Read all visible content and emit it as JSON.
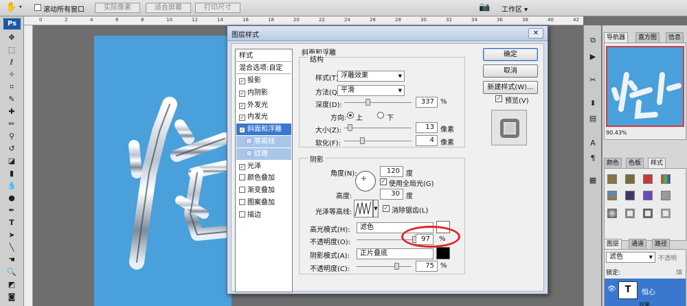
{
  "optionbar": {
    "scroll_all_label": "滚动所有窗口",
    "actual_pixels": "实际像素",
    "fit_screen": "适合屏幕",
    "print_size": "打印尺寸",
    "workspace": "工作区"
  },
  "toolbox": {
    "logo": "Ps"
  },
  "ruler_labels": [
    "0",
    "2",
    "4",
    "6",
    "8",
    "10",
    "12",
    "14",
    "16",
    "18",
    "20",
    "22",
    "24",
    "26",
    "28",
    "30",
    "32",
    "34",
    "36",
    "38",
    "40",
    "42"
  ],
  "canvas_text": "恒心",
  "dialog": {
    "title": "图层样式",
    "style_header": "样式",
    "blend_options": "混合选项:自定",
    "items": [
      {
        "label": "投影",
        "checked": true,
        "selected": false,
        "sub": false
      },
      {
        "label": "内阴影",
        "checked": true,
        "selected": false,
        "sub": false
      },
      {
        "label": "外发光",
        "checked": true,
        "selected": false,
        "sub": false
      },
      {
        "label": "内发光",
        "checked": true,
        "selected": false,
        "sub": false
      },
      {
        "label": "斜面和浮雕",
        "checked": true,
        "selected": true,
        "sub": false
      },
      {
        "label": "等高线",
        "checked": false,
        "selected": false,
        "sub": true
      },
      {
        "label": "纹理",
        "checked": false,
        "selected": false,
        "sub": true
      },
      {
        "label": "光泽",
        "checked": true,
        "selected": false,
        "sub": false
      },
      {
        "label": "颜色叠加",
        "checked": false,
        "selected": false,
        "sub": false
      },
      {
        "label": "渐变叠加",
        "checked": false,
        "selected": false,
        "sub": false
      },
      {
        "label": "图案叠加",
        "checked": false,
        "selected": false,
        "sub": false
      },
      {
        "label": "描边",
        "checked": false,
        "selected": false,
        "sub": false
      }
    ],
    "bevel": {
      "section": "斜面和浮雕",
      "structure": "结构",
      "style_label": "样式(T):",
      "style_value": "浮雕效果",
      "method_label": "方法(Q):",
      "method_value": "平滑",
      "depth_label": "深度(D):",
      "depth_value": "337",
      "depth_unit": "%",
      "depth_fraction": 0.34,
      "direction_label": "方向:",
      "dir_up": "上",
      "dir_down": "下",
      "size_label": "大小(Z):",
      "size_value": "13",
      "size_unit": "像素",
      "size_fraction": 0.05,
      "soften_label": "软化(F):",
      "soften_value": "4",
      "soften_unit": "像素",
      "soften_fraction": 0.25
    },
    "shading": {
      "section": "阴影",
      "angle_label": "角度(N):",
      "angle_value": "120",
      "angle_unit": "度",
      "global_light": "使用全局光(G)",
      "altitude_label": "高度:",
      "altitude_value": "30",
      "altitude_unit": "度",
      "gloss_label": "光泽等高线:",
      "antialias": "消除锯齿(L)",
      "highlight_mode_label": "高光模式(H):",
      "highlight_mode": "滤色",
      "opacity_label": "不透明度(O):",
      "opacity_value": "97",
      "opacity_unit": "%",
      "opacity_fraction": 0.97,
      "shadow_mode_label": "阴影模式(A):",
      "shadow_mode": "正片叠底",
      "shadow_opacity_label": "不透明度(C):",
      "shadow_opacity_value": "75",
      "shadow_opacity_unit": "%",
      "shadow_opacity_fraction": 0.75
    },
    "buttons": {
      "ok": "确定",
      "cancel": "取消",
      "new_style": "新建样式(W)...",
      "preview": "预览(V)"
    }
  },
  "panels": {
    "nav_tabs": [
      "导航器",
      "直方图",
      "信息"
    ],
    "zoom": "90.43%",
    "style_tabs": [
      "颜色",
      "色板",
      "样式"
    ],
    "layer_tabs": [
      "图层",
      "通道",
      "路径"
    ],
    "blend_mode": "滤色",
    "opacity_short": "不透明",
    "lock_label": "锁定:",
    "fill_short": "填",
    "layer_name": "恒心",
    "effects_label": "效果"
  },
  "colors": {
    "canvas": "#4aa0db",
    "highlight_circle": "#e0271f",
    "selected": "#3a78d0"
  }
}
